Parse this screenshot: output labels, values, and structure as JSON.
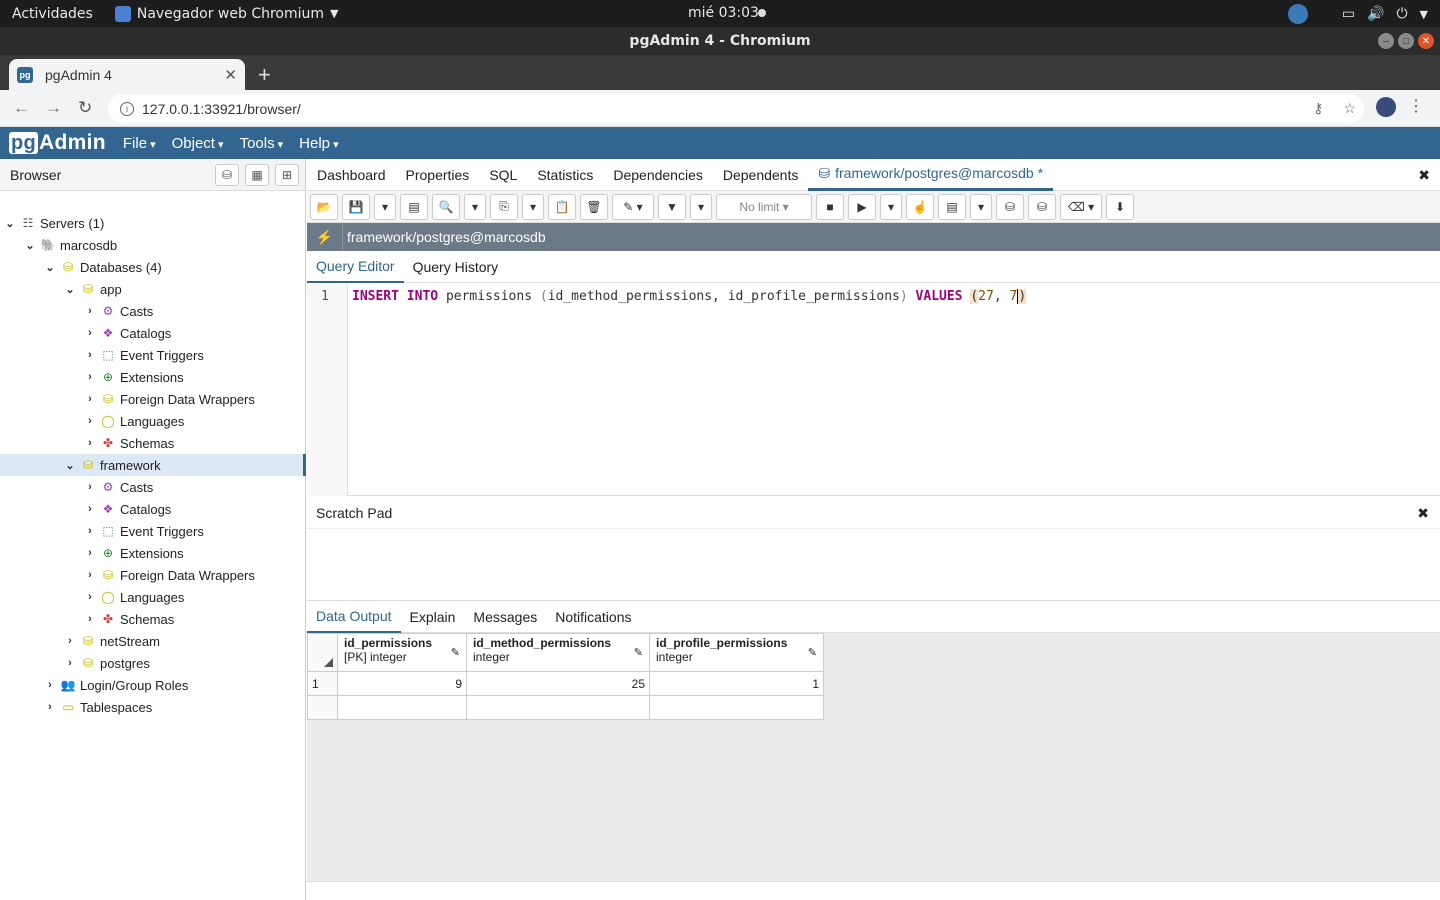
{
  "gnome": {
    "activities": "Actividades",
    "app_name": "Navegador web Chromium",
    "clock": "mié 03:03"
  },
  "window": {
    "title": "pgAdmin 4 - Chromium"
  },
  "browser": {
    "tab_title": "pgAdmin 4",
    "url": "127.0.0.1:33921/browser/"
  },
  "pgadmin": {
    "logo_pg": "pg",
    "logo_rest": "Admin",
    "menu": [
      "File",
      "Object",
      "Tools",
      "Help"
    ]
  },
  "left_panel": {
    "title": "Browser",
    "tree": [
      {
        "label": "Servers (1)",
        "icon": "servers-icon",
        "expanded": true,
        "depth": 0
      },
      {
        "label": "marcosdb",
        "icon": "elephant-icon",
        "expanded": true,
        "depth": 1
      },
      {
        "label": "Databases (4)",
        "icon": "databases-icon",
        "expanded": true,
        "depth": 2
      },
      {
        "label": "app",
        "icon": "database-icon",
        "expanded": true,
        "depth": 3
      },
      {
        "label": "Casts",
        "icon": "casts-icon",
        "expanded": false,
        "depth": 4
      },
      {
        "label": "Catalogs",
        "icon": "catalogs-icon",
        "expanded": false,
        "depth": 4
      },
      {
        "label": "Event Triggers",
        "icon": "event-triggers-icon",
        "expanded": false,
        "depth": 4
      },
      {
        "label": "Extensions",
        "icon": "extensions-icon",
        "expanded": false,
        "depth": 4
      },
      {
        "label": "Foreign Data Wrappers",
        "icon": "fdw-icon",
        "expanded": false,
        "depth": 4
      },
      {
        "label": "Languages",
        "icon": "languages-icon",
        "expanded": false,
        "depth": 4
      },
      {
        "label": "Schemas",
        "icon": "schemas-icon",
        "expanded": false,
        "depth": 4
      },
      {
        "label": "framework",
        "icon": "database-icon",
        "expanded": true,
        "depth": 3,
        "selected": true
      },
      {
        "label": "Casts",
        "icon": "casts-icon",
        "expanded": false,
        "depth": 4
      },
      {
        "label": "Catalogs",
        "icon": "catalogs-icon",
        "expanded": false,
        "depth": 4
      },
      {
        "label": "Event Triggers",
        "icon": "event-triggers-icon",
        "expanded": false,
        "depth": 4
      },
      {
        "label": "Extensions",
        "icon": "extensions-icon",
        "expanded": false,
        "depth": 4
      },
      {
        "label": "Foreign Data Wrappers",
        "icon": "fdw-icon",
        "expanded": false,
        "depth": 4
      },
      {
        "label": "Languages",
        "icon": "languages-icon",
        "expanded": false,
        "depth": 4
      },
      {
        "label": "Schemas",
        "icon": "schemas-icon",
        "expanded": false,
        "depth": 4
      },
      {
        "label": "netStream",
        "icon": "database-icon",
        "expanded": false,
        "depth": 3
      },
      {
        "label": "postgres",
        "icon": "database-icon",
        "expanded": false,
        "depth": 3
      },
      {
        "label": "Login/Group Roles",
        "icon": "roles-icon",
        "expanded": false,
        "depth": 2
      },
      {
        "label": "Tablespaces",
        "icon": "tablespaces-icon",
        "expanded": false,
        "depth": 2
      }
    ]
  },
  "main": {
    "tabs": [
      "Dashboard",
      "Properties",
      "SQL",
      "Statistics",
      "Dependencies",
      "Dependents"
    ],
    "query_tab": "framework/postgres@marcosdb *",
    "limit_label": "No limit",
    "connection": "framework/postgres@marcosdb",
    "query_tabs": [
      "Query Editor",
      "Query History"
    ],
    "editor": {
      "line_number": "1",
      "tokens": {
        "kw1": "INSERT",
        "kw2": "INTO",
        "table": "permissions",
        "paren_open": "(",
        "cols": "id_method_permissions, id_profile_permissions",
        "paren_close": ")",
        "kw3": "VALUES",
        "vopen": "(",
        "v1": "27",
        "comma": ", ",
        "v2": "7",
        "vclose": ")"
      }
    },
    "scratch_pad": "Scratch Pad",
    "output_tabs": [
      "Data Output",
      "Explain",
      "Messages",
      "Notifications"
    ],
    "grid": {
      "columns": [
        {
          "name": "id_permissions",
          "type": "[PK] integer"
        },
        {
          "name": "id_method_permissions",
          "type": "integer"
        },
        {
          "name": "id_profile_permissions",
          "type": "integer"
        }
      ],
      "rows": [
        {
          "n": "1",
          "values": [
            "9",
            "25",
            "1"
          ]
        }
      ]
    }
  }
}
